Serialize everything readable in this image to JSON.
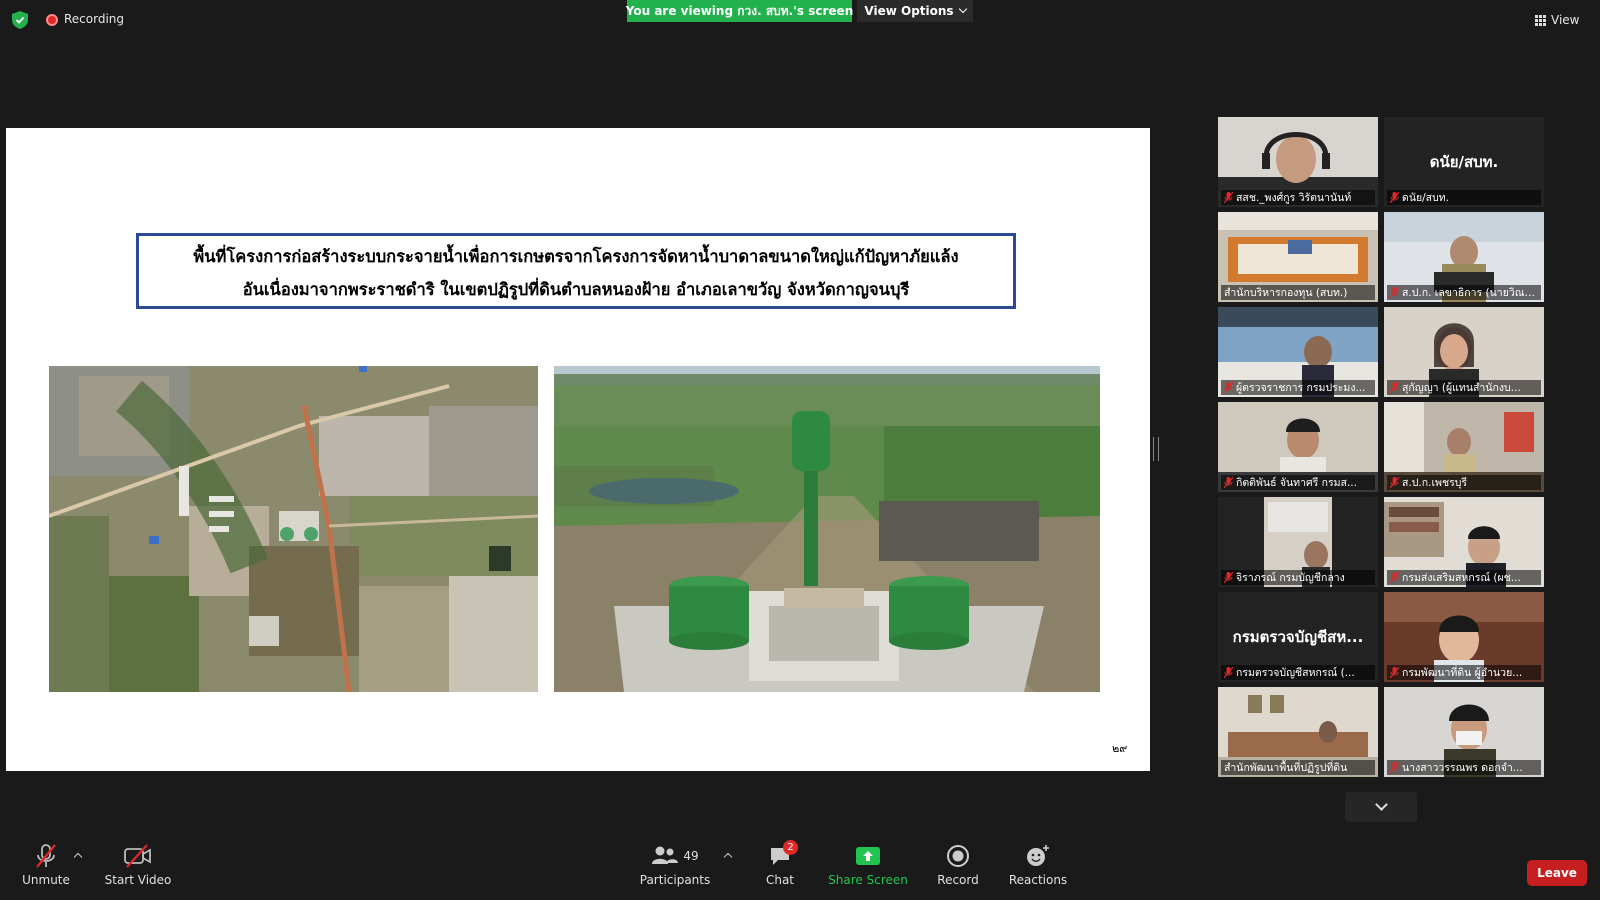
{
  "topbar": {
    "recording_label": "Recording",
    "viewing_banner": "You are viewing กวง. สบท.'s screen",
    "view_options_label": "View Options",
    "view_label": "View"
  },
  "slide": {
    "title_line1": "พื้นที่โครงการก่อสร้างระบบกระจายน้ำเพื่อการเกษตรจากโครงการจัดหาน้ำบาดาลขนาดใหญ่แก้ปัญหาภัยแล้ง",
    "title_line2": "อันเนื่องมาจากพระราชดำริ ในเขตปฏิรูปที่ดินตำบลหนองฝ้าย อำเภอเลาขวัญ จังหวัดกาญจนบุรี",
    "page_number": "๒๙"
  },
  "participants": [
    {
      "name": "สสช._พงศ์กูร วิรัตนานันท์",
      "big": ""
    },
    {
      "name": "ดนัย/สบท.",
      "big": "ดนัย/สบท."
    },
    {
      "name": "สำนักบริหารกองทุน (สบท.)",
      "big": ""
    },
    {
      "name": "ส.ป.ก. เลขาธิการ (นายวิณะโ...",
      "big": ""
    },
    {
      "name": "ผู้ตรวจราชการ กรมประมง...",
      "big": ""
    },
    {
      "name": "สุกัญญา (ผู้แทนสำนักงบ...",
      "big": ""
    },
    {
      "name": "กิตติพันธ์ จันทาศรี กรมส...",
      "big": ""
    },
    {
      "name": "ส.ป.ก.เพชรบุรี",
      "big": ""
    },
    {
      "name": "จิราภรณ์ กรมบัญชีกลาง",
      "big": ""
    },
    {
      "name": "กรมส่งเสริมสหกรณ์ (ผช...",
      "big": ""
    },
    {
      "name": "กรมตรวจบัญชีสหกรณ์ (...",
      "big": "กรมตรวจบัญชีสห..."
    },
    {
      "name": "กรมพัฒนาที่ดิน ผู้อำนวย...",
      "big": ""
    },
    {
      "name": "สำนักพัฒนาพื้นที่ปฏิรูปที่ดิน",
      "big": ""
    },
    {
      "name": "นางสาววรรณพร ดอกจำ...",
      "big": ""
    }
  ],
  "toolbar": {
    "unmute_label": "Unmute",
    "start_video_label": "Start Video",
    "participants_label": "Participants",
    "participants_count": "49",
    "chat_label": "Chat",
    "chat_badge": "2",
    "share_screen_label": "Share Screen",
    "record_label": "Record",
    "reactions_label": "Reactions",
    "leave_label": "Leave"
  },
  "colors": {
    "banner_green": "#23b14d",
    "leave_red": "#c71f1f",
    "active_speaker": "#f5d90a",
    "title_border": "#2b4a93"
  }
}
